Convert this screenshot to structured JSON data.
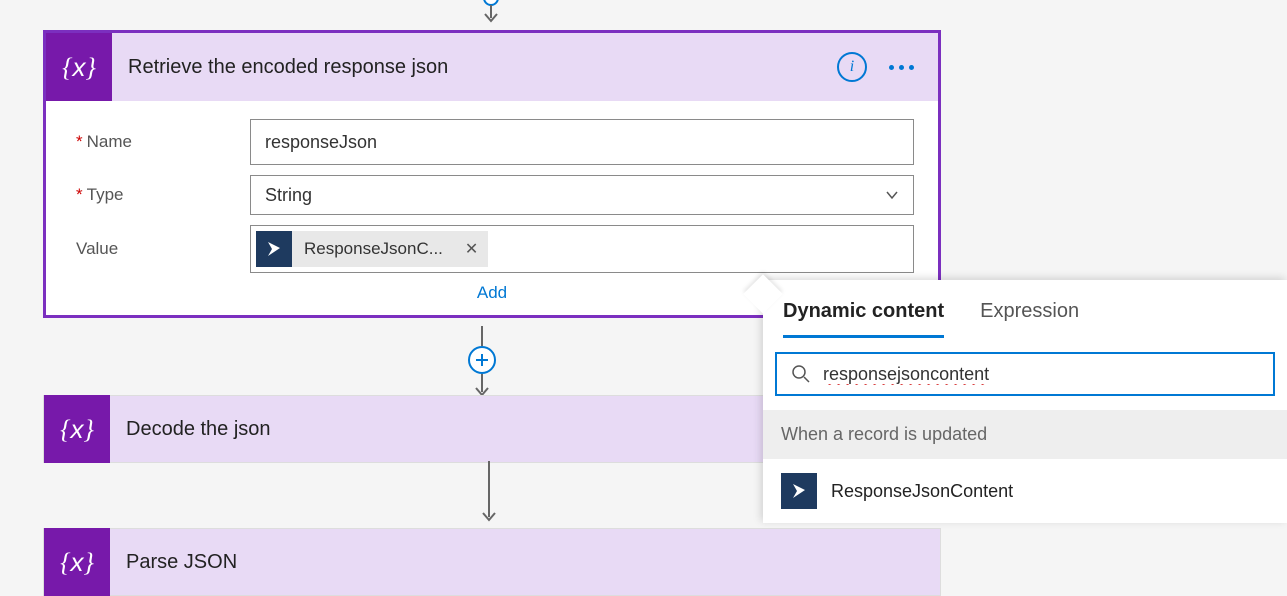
{
  "action1": {
    "title": "Retrieve the encoded response json",
    "icon": "variable-icon",
    "fields": {
      "nameLabel": "Name",
      "nameValue": "responseJson",
      "typeLabel": "Type",
      "typeValue": "String",
      "valueLabel": "Value",
      "token": {
        "label": "ResponseJsonC...",
        "icon": "dynamics-icon"
      }
    },
    "addLink": "Add"
  },
  "action2": {
    "title": "Decode the json",
    "icon": "variable-icon"
  },
  "action3": {
    "title": "Parse JSON"
  },
  "popup": {
    "tabs": {
      "dynamic": "Dynamic content",
      "expression": "Expression"
    },
    "searchValue": "responsejsoncontent",
    "section": "When a record is updated",
    "item": {
      "label": "ResponseJsonContent",
      "icon": "dynamics-icon"
    }
  }
}
